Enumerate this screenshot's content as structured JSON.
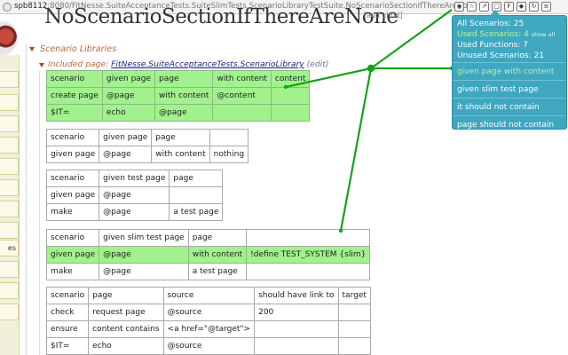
{
  "browser": {
    "url_host": "spb8112",
    "url_path": ":8080/FitNesse.SuiteAcceptanceTests.SuiteSlimTests.ScenarioLibraryTestSuite.NoScenarioSectionIfThereAreNone",
    "extension_icons": [
      "eye-icon",
      "bookmark-icon",
      "share-icon",
      "window-icon",
      "f-icon",
      "fitnesse-ext-icon",
      "refresh-icon",
      "menu-icon"
    ]
  },
  "page": {
    "title": "NoScenarioSectionIfThereAreNone",
    "add_child": "[add child]"
  },
  "sidebar": {
    "buttons": [
      "",
      "",
      "",
      "",
      "",
      "",
      "",
      "",
      "es",
      "",
      "",
      ""
    ]
  },
  "section": {
    "title": "Scenario Libraries",
    "include_prefix": "Included page:",
    "include_link": " FitNesse.SuiteAcceptanceTests.ScenarioLibrary",
    "include_edit": "(edit)"
  },
  "tables": [
    {
      "rows": [
        {
          "pass": true,
          "cells": [
            "scenario",
            "given page",
            "page",
            "with content",
            "content"
          ]
        },
        {
          "pass": true,
          "cells": [
            "create page",
            "@page",
            "with content",
            "@content",
            ""
          ]
        },
        {
          "pass": true,
          "cells": [
            "$IT=",
            "echo",
            "@page",
            "",
            ""
          ]
        }
      ]
    },
    {
      "rows": [
        {
          "pass": false,
          "cells": [
            "scenario",
            "given page",
            "page",
            ""
          ]
        },
        {
          "pass": false,
          "cells": [
            "given page",
            "@page",
            "with content",
            "nothing"
          ]
        }
      ]
    },
    {
      "rows": [
        {
          "pass": false,
          "cells": [
            "scenario",
            "given test page",
            "page"
          ]
        },
        {
          "pass": false,
          "cells": [
            "given page",
            "@page",
            ""
          ]
        },
        {
          "pass": false,
          "cells": [
            "make",
            "@page",
            "a test page"
          ]
        }
      ]
    },
    {
      "rows": [
        {
          "pass": false,
          "cells": [
            "scenario",
            "given slim test page",
            "page",
            ""
          ]
        },
        {
          "pass": true,
          "cells": [
            "given page",
            "@page",
            "with content",
            "!define TEST_SYSTEM {slim}"
          ]
        },
        {
          "pass": false,
          "cells": [
            "make",
            "@page",
            "a test page",
            ""
          ]
        }
      ]
    },
    {
      "rows": [
        {
          "pass": false,
          "cells": [
            "scenario",
            "page",
            "source",
            "should have link to",
            "target"
          ]
        },
        {
          "pass": false,
          "cells": [
            "check",
            "request page",
            "@source",
            "200",
            ""
          ]
        },
        {
          "pass": false,
          "cells": [
            "ensure",
            "content contains",
            "<a href=\"@target\">",
            "",
            ""
          ]
        },
        {
          "pass": false,
          "cells": [
            "$IT=",
            "echo",
            "@source",
            "",
            ""
          ]
        }
      ]
    }
  ],
  "popup": {
    "all_scenarios": "All Scenarios: 25",
    "used_scenarios": "Used Scenarios: 4",
    "show_all": "show all",
    "used_functions": "Used Functions: 7",
    "unused_scenarios": "Unused Scenarios: 21",
    "items": [
      {
        "label": "given page with content",
        "active": true
      },
      {
        "label": "given slim test page",
        "active": false
      },
      {
        "label": "it should not contain",
        "active": false
      },
      {
        "label": "page should not contain",
        "active": false
      }
    ]
  },
  "colors": {
    "pass": "#a1f28c",
    "popup_bg": "#3fa7bf",
    "connector": "#15a315",
    "section_title": "#b96b3c"
  }
}
